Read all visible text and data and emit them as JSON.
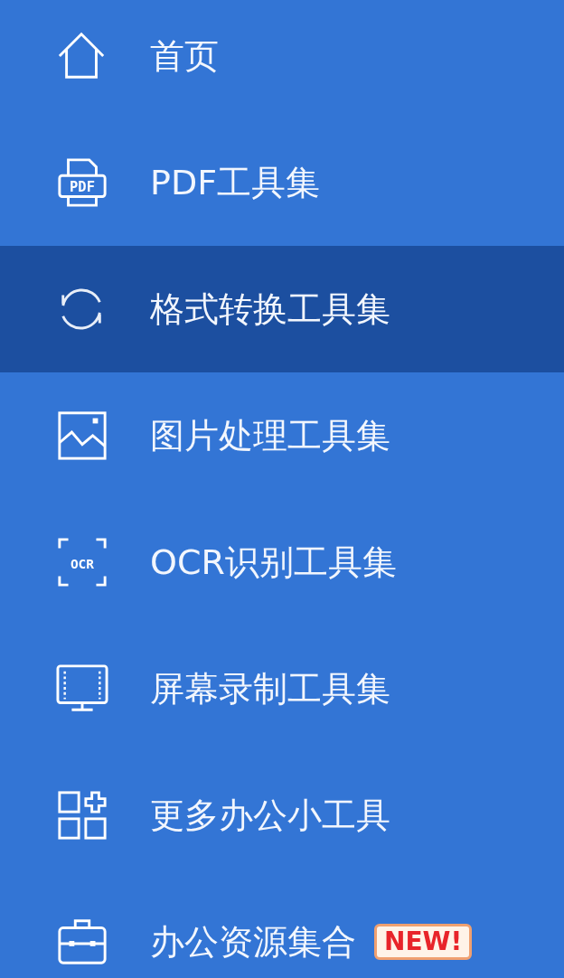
{
  "sidebar": {
    "items": [
      {
        "label": "首页",
        "selected": false
      },
      {
        "label": "PDF工具集",
        "selected": false,
        "icon_text": "PDF"
      },
      {
        "label": "格式转换工具集",
        "selected": true
      },
      {
        "label": "图片处理工具集",
        "selected": false
      },
      {
        "label": "OCR识别工具集",
        "selected": false,
        "icon_text": "OCR"
      },
      {
        "label": "屏幕录制工具集",
        "selected": false
      },
      {
        "label": "更多办公小工具",
        "selected": false
      },
      {
        "label": "办公资源集合",
        "selected": false,
        "badge": "NEW!"
      }
    ]
  }
}
